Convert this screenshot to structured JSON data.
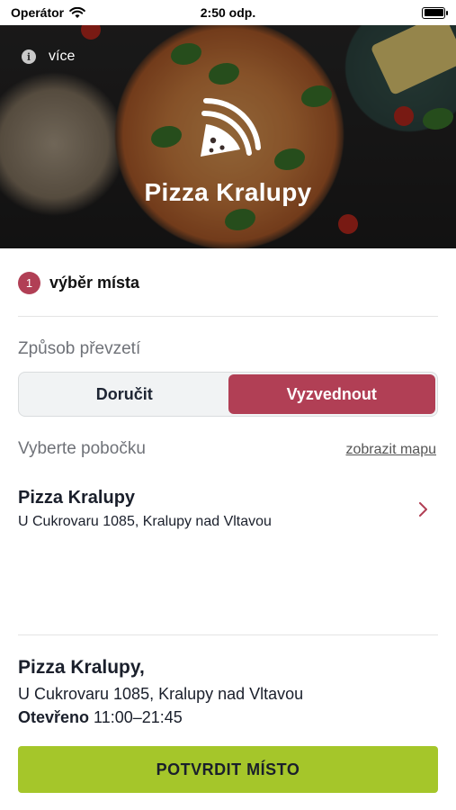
{
  "status_bar": {
    "carrier": "Operátor",
    "time": "2:50 odp.",
    "icons": [
      "wifi-icon",
      "battery-icon"
    ]
  },
  "header": {
    "more_label": "více",
    "brand_name": "Pizza Kralupy",
    "logo_icon": "pizza-slice-icon"
  },
  "steps": {
    "number": "1",
    "label": "výběr místa"
  },
  "pickup": {
    "label": "Způsob převzetí",
    "options": [
      {
        "label": "Doručit",
        "selected": false
      },
      {
        "label": "Vyzvednout",
        "selected": true
      }
    ]
  },
  "branch": {
    "label": "Vyberte pobočku",
    "map_link": "zobrazit mapu",
    "items": [
      {
        "name": "Pizza Kralupy",
        "address": "U Cukrovaru 1085, Kralupy nad Vltavou"
      }
    ]
  },
  "summary": {
    "name": "Pizza Kralupy,",
    "address": "U Cukrovaru 1085, Kralupy nad Vltavou",
    "open_label": "Otevřeno",
    "hours": "11:00–21:45"
  },
  "confirm_button": "POTVRDIT MÍSTO",
  "colors": {
    "accent": "#b13f55",
    "confirm": "#a5c62a",
    "text": "#1a1f2b"
  }
}
